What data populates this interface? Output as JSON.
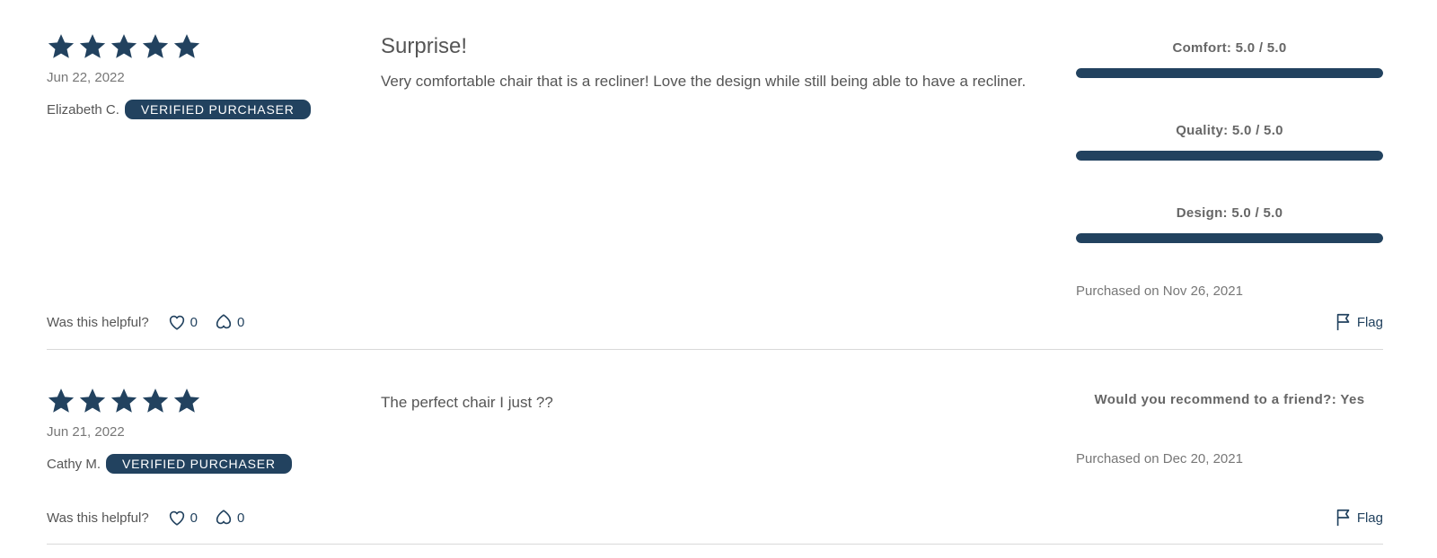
{
  "colors": {
    "accent": "#22425f",
    "text": "#555555",
    "muted": "#777777",
    "divider": "#d9d9d9"
  },
  "icons": {
    "star": "star-icon",
    "helpful": "heart-icon",
    "unhelpful": "heart-down-icon",
    "flag": "flag-icon"
  },
  "reviews": [
    {
      "rating": 5,
      "date": "Jun 22, 2022",
      "author": "Elizabeth C.",
      "badge": "VERIFIED PURCHASER",
      "title": "Surprise!",
      "body": "Very comfortable chair that is a recliner! Love the design while still being able to have a recliner.",
      "ratings": [
        {
          "label": "Comfort: 5.0 / 5.0",
          "value": 5.0,
          "max": 5.0
        },
        {
          "label": "Quality: 5.0 / 5.0",
          "value": 5.0,
          "max": 5.0
        },
        {
          "label": "Design: 5.0 / 5.0",
          "value": 5.0,
          "max": 5.0
        }
      ],
      "purchased": "Purchased on Nov 26, 2021",
      "helpful_label": "Was this helpful?",
      "helpful_up": "0",
      "helpful_down": "0",
      "flag_label": "Flag"
    },
    {
      "rating": 5,
      "date": "Jun 21, 2022",
      "author": "Cathy M.",
      "badge": "VERIFIED PURCHASER",
      "title": "",
      "body": "The perfect chair I just ??",
      "recommend": "Would you recommend to a friend?: Yes",
      "purchased": "Purchased on Dec 20, 2021",
      "helpful_label": "Was this helpful?",
      "helpful_up": "0",
      "helpful_down": "0",
      "flag_label": "Flag"
    }
  ]
}
